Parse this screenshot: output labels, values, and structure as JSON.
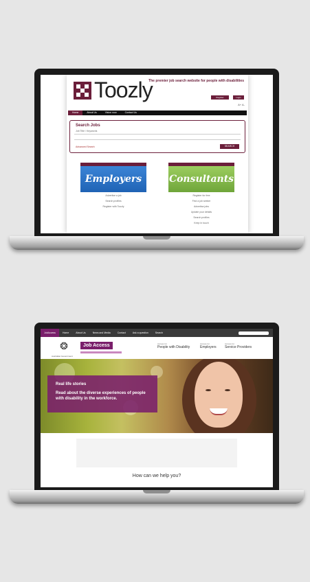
{
  "laptop1": {
    "site": "Toozly",
    "tagline": "The premier job search website for people with disabilities",
    "header_buttons": [
      "Register",
      "Login"
    ],
    "font_size_label": "A+ A-",
    "nav": [
      "Home",
      "About Us",
      "Vision now",
      "Contact Us"
    ],
    "search": {
      "heading": "Search Jobs",
      "prompt": "Job Title / Keywords",
      "advanced_link": "Advanced Search",
      "button": "SEARCH"
    },
    "employers": {
      "title": "Employers",
      "links": [
        "Advertise a job",
        "Search profiles",
        "Register with Toozly"
      ]
    },
    "consultants": {
      "title": "Consultants",
      "links": [
        "Register for free",
        "Find a job seeker",
        "Advertise jobs",
        "Update your details",
        "Search profiles",
        "Keep in touch"
      ]
    }
  },
  "laptop2": {
    "topbar": [
      "JobAccess",
      "Home",
      "About Us",
      "News and Media",
      "Contact",
      "Ask a question"
    ],
    "topbar_right": "Search",
    "brand": "Job Access",
    "gov_label": "Australian Government",
    "audiences": [
      {
        "small": "Access for",
        "label": "People with Disability"
      },
      {
        "small": "Access for",
        "label": "Employers"
      },
      {
        "small": "Access for",
        "label": "Service Providers"
      }
    ],
    "hero": {
      "eyebrow": "Real life stories",
      "headline": "Read about the diverse experiences of people with disability in the workforce."
    },
    "notice": "",
    "help": "How can we help you?"
  },
  "colors": {
    "toozly_brand": "#6b1e3a",
    "employers_panel": "#1f63b5",
    "consultants_panel": "#7cb342",
    "jobaccess_brand": "#7a1f6b",
    "background": "#e6e6e6"
  }
}
